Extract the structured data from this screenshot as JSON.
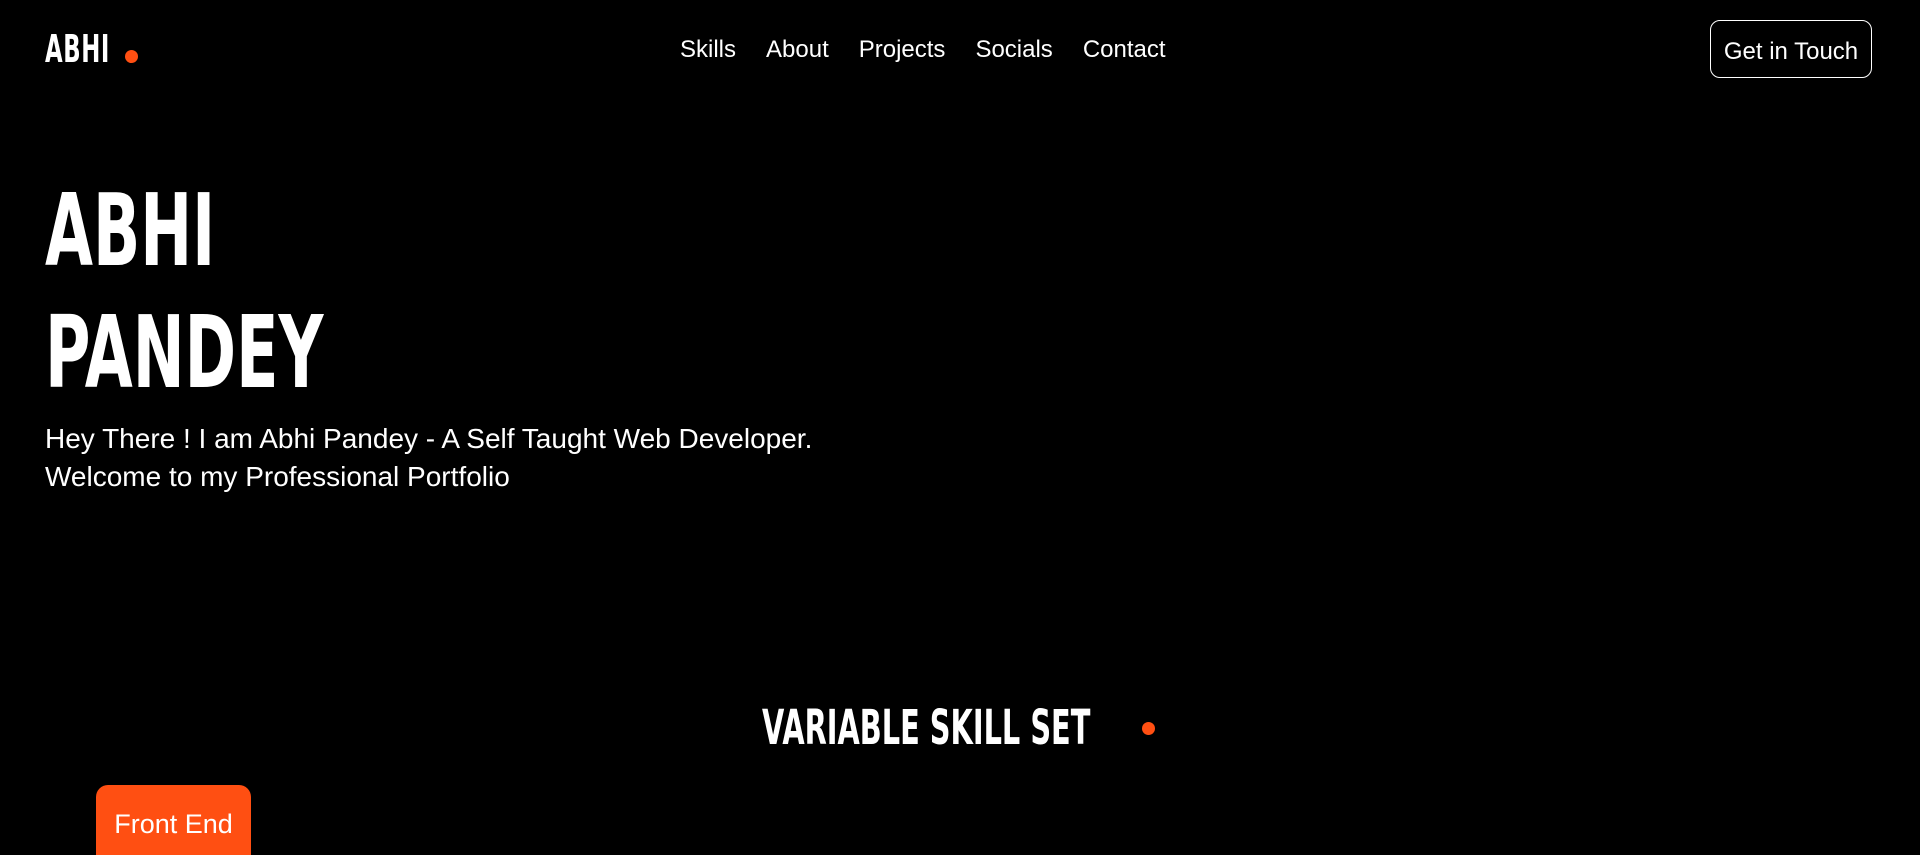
{
  "header": {
    "logo_text": "ABHI",
    "nav": [
      {
        "label": "Skills"
      },
      {
        "label": "About"
      },
      {
        "label": "Projects"
      },
      {
        "label": "Socials"
      },
      {
        "label": "Contact"
      }
    ],
    "cta_label": "Get in Touch"
  },
  "hero": {
    "first_name": "ABHI",
    "last_name": "PANDEY",
    "intro_line1": "Hey There ! I am Abhi Pandey - A Self Taught Web Developer.",
    "intro_line2": "Welcome to my Professional Portfolio"
  },
  "skills": {
    "heading": "VARIABLE SKILL SET",
    "tabs": [
      {
        "label": "Front End"
      }
    ]
  },
  "colors": {
    "background": "#000000",
    "text": "#ffffff",
    "accent": "#ff4f12"
  }
}
